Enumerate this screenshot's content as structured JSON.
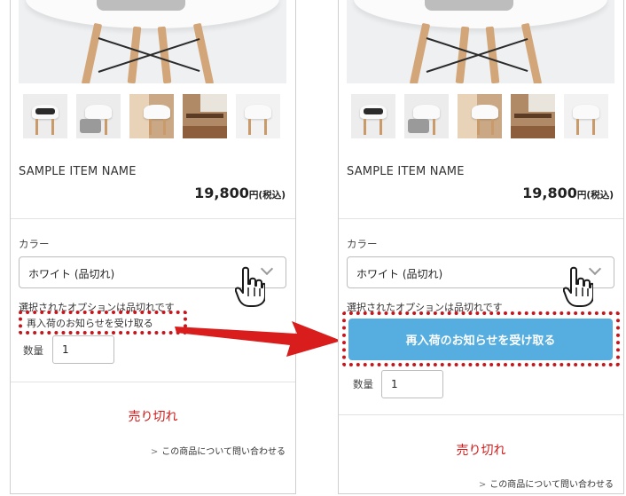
{
  "product": {
    "name": "SAMPLE ITEM NAME",
    "price": "19,800",
    "price_unit": "円(税込)"
  },
  "option": {
    "label": "カラー",
    "selected": "ホワイト (品切れ)"
  },
  "messages": {
    "out_of_stock_option": "選択されたオプションは品切れです",
    "notify_link": "再入荷のお知らせを受け取る",
    "notify_button": "再入荷のお知らせを受け取る"
  },
  "quantity": {
    "label": "数量",
    "value": "1"
  },
  "status": {
    "sold_out": "売り切れ"
  },
  "inquiry": {
    "label": "この商品について問い合わせる",
    "icon": "chevron-right-icon"
  },
  "colors": {
    "highlight_dotted": "#c8151b",
    "arrow": "#d91c1c",
    "notify_button": "#55aedf",
    "sold_out_text": "#d01919"
  },
  "icons": [
    "hand-pointer-icon",
    "chevron-down-icon",
    "chevron-right-icon"
  ]
}
